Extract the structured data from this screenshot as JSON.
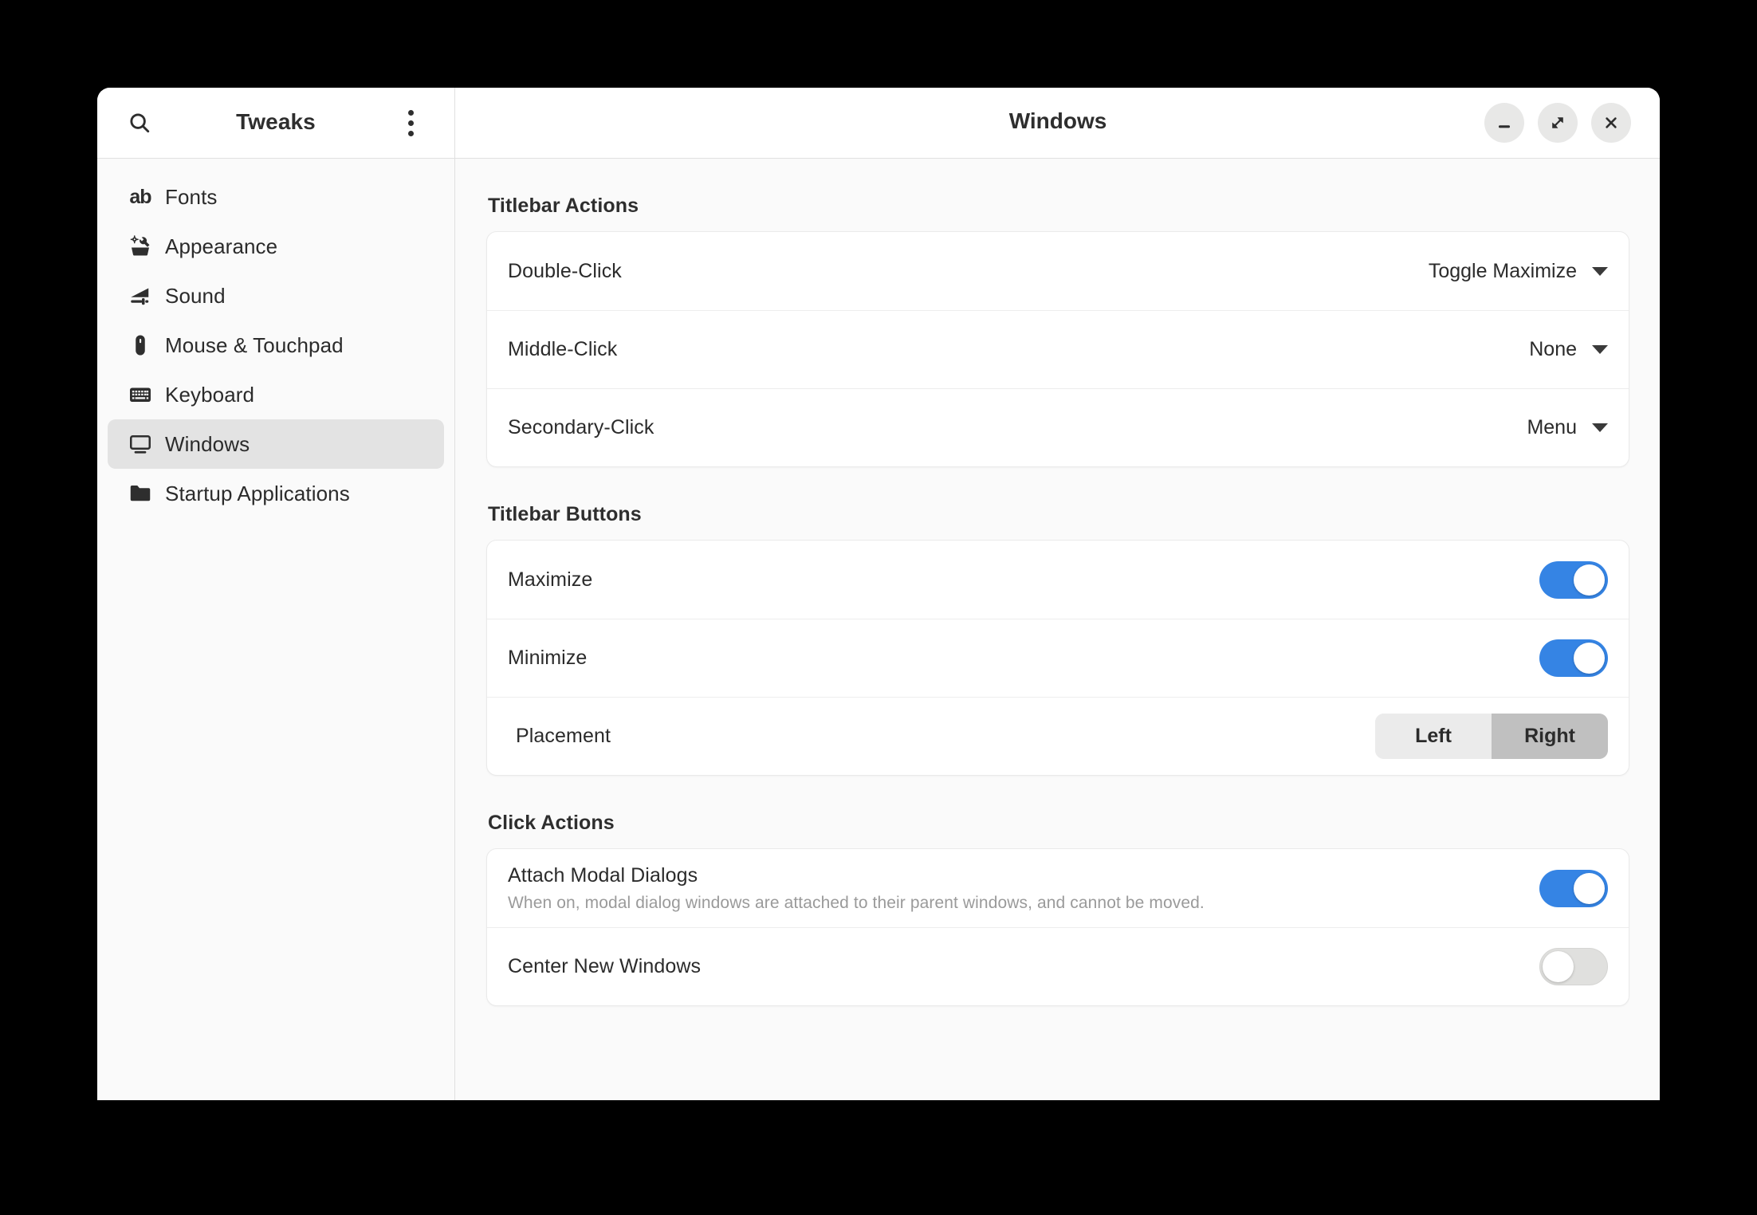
{
  "window": {
    "app_title": "Tweaks",
    "page_title": "Windows",
    "search_icon": "search-icon",
    "menu_icon": "menu-kebab-icon",
    "controls": [
      {
        "name": "minimize-button",
        "icon": "minimize-icon",
        "label": "—"
      },
      {
        "name": "restore-button",
        "icon": "restore-icon",
        "label": "⤡"
      },
      {
        "name": "close-button",
        "icon": "close-icon",
        "label": "✕"
      }
    ]
  },
  "sidebar": {
    "items": [
      {
        "label": "Fonts",
        "icon": "fonts-ab-icon",
        "selected": false
      },
      {
        "label": "Appearance",
        "icon": "appearance-toolbox-icon",
        "selected": false
      },
      {
        "label": "Sound",
        "icon": "sound-slider-icon",
        "selected": false
      },
      {
        "label": "Mouse & Touchpad",
        "icon": "mouse-icon",
        "selected": false
      },
      {
        "label": "Keyboard",
        "icon": "keyboard-icon",
        "selected": false
      },
      {
        "label": "Windows",
        "icon": "window-display-icon",
        "selected": true
      },
      {
        "label": "Startup Applications",
        "icon": "folder-icon",
        "selected": false
      }
    ]
  },
  "main": {
    "sections": [
      {
        "title": "Titlebar Actions",
        "rows": [
          {
            "label": "Double-Click",
            "control": "dropdown",
            "value": "Toggle Maximize"
          },
          {
            "label": "Middle-Click",
            "control": "dropdown",
            "value": "None"
          },
          {
            "label": "Secondary-Click",
            "control": "dropdown",
            "value": "Menu"
          }
        ]
      },
      {
        "title": "Titlebar Buttons",
        "rows": [
          {
            "label": "Maximize",
            "control": "toggle",
            "value": "on"
          },
          {
            "label": "Minimize",
            "control": "toggle",
            "value": "on"
          },
          {
            "label": "Placement",
            "control": "segmented",
            "options": [
              "Left",
              "Right"
            ],
            "value": "Right"
          }
        ]
      },
      {
        "title": "Click Actions",
        "rows": [
          {
            "label": "Attach Modal Dialogs",
            "description": "When on, modal dialog windows are attached to their parent windows, and cannot be moved.",
            "control": "toggle",
            "value": "on"
          },
          {
            "label": "Center New Windows",
            "control": "toggle",
            "value": "off"
          }
        ]
      }
    ]
  },
  "colors": {
    "accent": "#3584E4",
    "window_bg": "#FAFAFA",
    "card_bg": "#FFFFFF",
    "selected_bg": "#E3E3E3",
    "segment_active_bg": "#C0C0C0"
  }
}
